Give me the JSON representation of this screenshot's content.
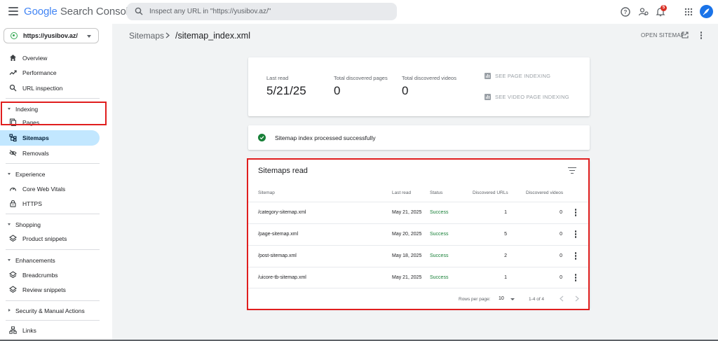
{
  "app": {
    "logo_google": "Google",
    "logo_product": "Search Console"
  },
  "search": {
    "placeholder": "Inspect any URL in \"https://yusibov.az/\""
  },
  "notifications": {
    "count": "5"
  },
  "property": {
    "label": "https://yusibov.az/"
  },
  "sidebar": {
    "overview": "Overview",
    "performance": "Performance",
    "url_inspection": "URL inspection",
    "indexing": "Indexing",
    "pages": "Pages",
    "sitemaps": "Sitemaps",
    "removals": "Removals",
    "experience": "Experience",
    "core_web_vitals": "Core Web Vitals",
    "https": "HTTPS",
    "shopping": "Shopping",
    "product_snippets": "Product snippets",
    "enhancements": "Enhancements",
    "breadcrumbs": "Breadcrumbs",
    "review_snippets": "Review snippets",
    "security": "Security & Manual Actions",
    "links": "Links"
  },
  "header": {
    "crumb_parent": "Sitemaps",
    "crumb_current": "/sitemap_index.xml",
    "open_sitemap": "OPEN SITEMAP"
  },
  "summary": {
    "last_read_label": "Last read",
    "last_read_value": "5/21/25",
    "pages_label": "Total discovered pages",
    "pages_value": "0",
    "videos_label": "Total discovered videos",
    "videos_value": "0",
    "see_page_indexing": "SEE PAGE INDEXING",
    "see_video_indexing": "SEE VIDEO PAGE INDEXING"
  },
  "status": {
    "message": "Sitemap index processed successfully"
  },
  "sitemaps_read": {
    "title": "Sitemaps read",
    "columns": {
      "sitemap": "Sitemap",
      "last_read": "Last read",
      "status": "Status",
      "discovered_urls": "Discovered URLs",
      "discovered_videos": "Discovered videos"
    },
    "rows": [
      {
        "sitemap": "/category-sitemap.xml",
        "last_read": "May 21, 2025",
        "status": "Success",
        "urls": "1",
        "videos": "0"
      },
      {
        "sitemap": "/page-sitemap.xml",
        "last_read": "May 20, 2025",
        "status": "Success",
        "urls": "5",
        "videos": "0"
      },
      {
        "sitemap": "/post-sitemap.xml",
        "last_read": "May 18, 2025",
        "status": "Success",
        "urls": "2",
        "videos": "0"
      },
      {
        "sitemap": "/uicore-tb-sitemap.xml",
        "last_read": "May 21, 2025",
        "status": "Success",
        "urls": "1",
        "videos": "0"
      }
    ],
    "rows_per_page_label": "Rows per page:",
    "rows_per_page_value": "10",
    "range": "1-4 of 4"
  },
  "colors": {
    "accent": "#1a73e8",
    "success": "#188038",
    "selected_bg": "#c2e7ff",
    "highlight": "#e01e1e"
  }
}
